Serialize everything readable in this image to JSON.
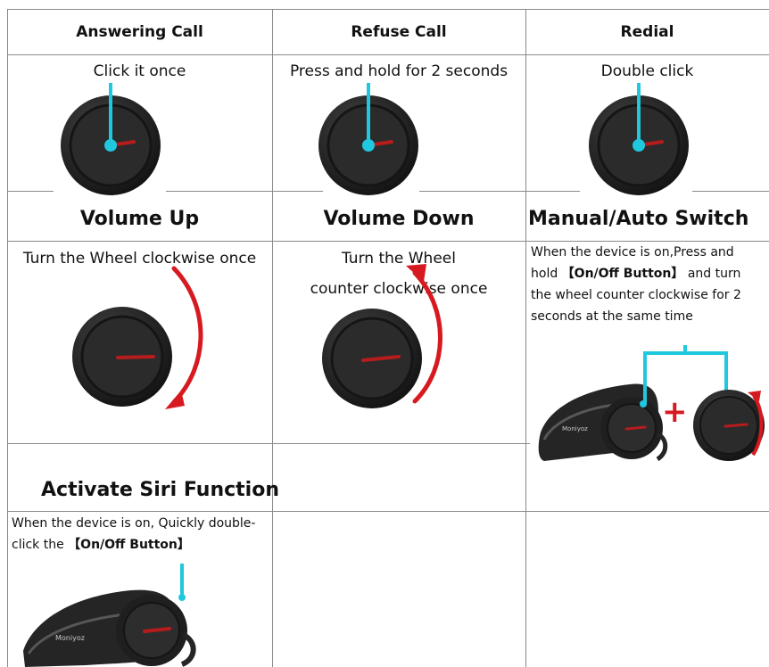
{
  "row1": {
    "answering": {
      "title": "Answering Call",
      "instruction": "Click it once"
    },
    "refuse": {
      "title": "Refuse Call",
      "instruction": "Press and hold for 2 seconds"
    },
    "redial": {
      "title": "Redial",
      "instruction": "Double click"
    }
  },
  "row2": {
    "volume_up": {
      "title": "Volume Up",
      "instruction": "Turn the Wheel clockwise once"
    },
    "volume_down": {
      "title": "Volume Down",
      "instruction_line1": "Turn the Wheel",
      "instruction_line2": "counter clockwise once"
    },
    "manual_auto": {
      "title": "Manual/Auto Switch",
      "instruction_before": "When the device is on,Press and hold",
      "button_text": "【On/Off Button】",
      "instruction_after": "and turn the wheel counter clockwise for 2 seconds at the same time",
      "plus_symbol": "+"
    }
  },
  "row3": {
    "siri": {
      "title": "Activate Siri Function",
      "instruction_before": "When the device is on, Quickly double-click the",
      "button_text": "【On/Off Button】"
    }
  },
  "brand_logo_text": "Moniyoz",
  "colors": {
    "pointer": "#20c8df",
    "indicator": "#b71c1c",
    "arrow": "#d71920",
    "grid": "#8a8a8a",
    "dial_outer": "#1f1f1f",
    "dial_inner": "#2b2b2b"
  },
  "icons": {
    "dial": "rotary-wheel-icon",
    "pointer": "cyan-pointer-icon",
    "clockwise": "clockwise-arrow-icon",
    "counterclockwise": "counterclockwise-arrow-icon",
    "device": "headset-device-icon",
    "plus": "plus-icon"
  }
}
